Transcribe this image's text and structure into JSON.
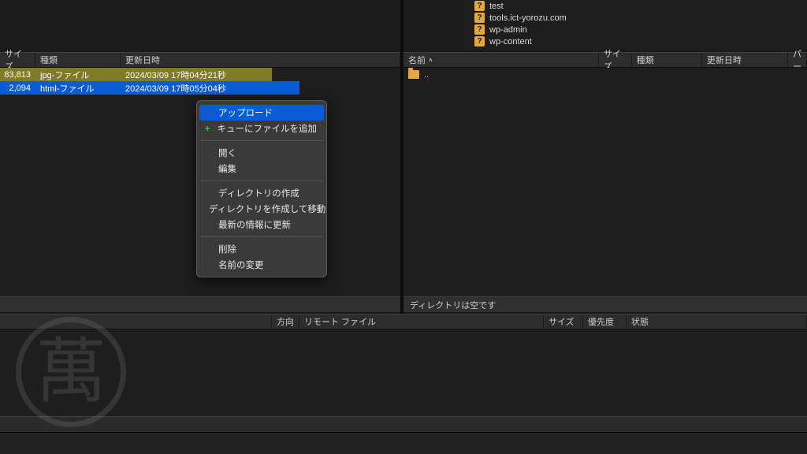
{
  "local": {
    "headers": {
      "size": "サイズ",
      "type": "種類",
      "date": "更新日時"
    },
    "rows": [
      {
        "size": "83,813",
        "type": "jpg-ファイル",
        "date": "2024/03/09 17時04分21秒",
        "state": "olive"
      },
      {
        "size": "2,094",
        "type": "html-ファイル",
        "date": "2024/03/09 17時05分04秒",
        "state": "blue"
      }
    ]
  },
  "remote": {
    "tree": [
      {
        "label": "test"
      },
      {
        "label": "tools.ict-yorozu.com"
      },
      {
        "label": "wp-admin"
      },
      {
        "label": "wp-content"
      }
    ],
    "headers": {
      "name": "名前",
      "size": "サイズ",
      "type": "種類",
      "date": "更新日時",
      "perm": "パー"
    },
    "updir": "..",
    "status": "ディレクトリは空です"
  },
  "queue": {
    "headers": {
      "dir": "方向",
      "remote": "リモート ファイル",
      "size": "サイズ",
      "priority": "優先度",
      "status": "状態"
    }
  },
  "context_menu": {
    "upload": "アップロード",
    "add_queue": "キューにファイルを追加",
    "open": "開く",
    "edit": "編集",
    "mkdir": "ディレクトリの作成",
    "mkdir_cd": "ディレクトリを作成して移動",
    "refresh": "最新の情報に更新",
    "delete": "削除",
    "rename": "名前の変更"
  },
  "watermark": "萬"
}
